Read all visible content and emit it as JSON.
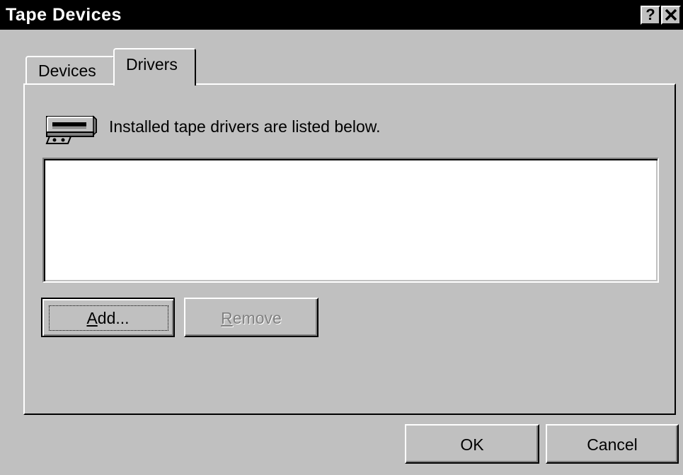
{
  "window": {
    "title": "Tape Devices",
    "help_label": "?",
    "close_label": "✕"
  },
  "tabs": [
    {
      "label": "Devices",
      "active": false
    },
    {
      "label": "Drivers",
      "active": true
    }
  ],
  "drivers_tab": {
    "info_icon": "tape-drive-icon",
    "info_text": "Installed tape drivers are listed below.",
    "drivers_list": [],
    "add_button": {
      "mnemonic": "A",
      "rest": "dd..."
    },
    "remove_button": {
      "mnemonic": "R",
      "rest": "emove",
      "enabled": false
    }
  },
  "footer": {
    "ok_label": "OK",
    "cancel_label": "Cancel"
  },
  "colors": {
    "face": "#c0c0c0",
    "titlebar": "#000000",
    "disabled_text": "#808080"
  }
}
